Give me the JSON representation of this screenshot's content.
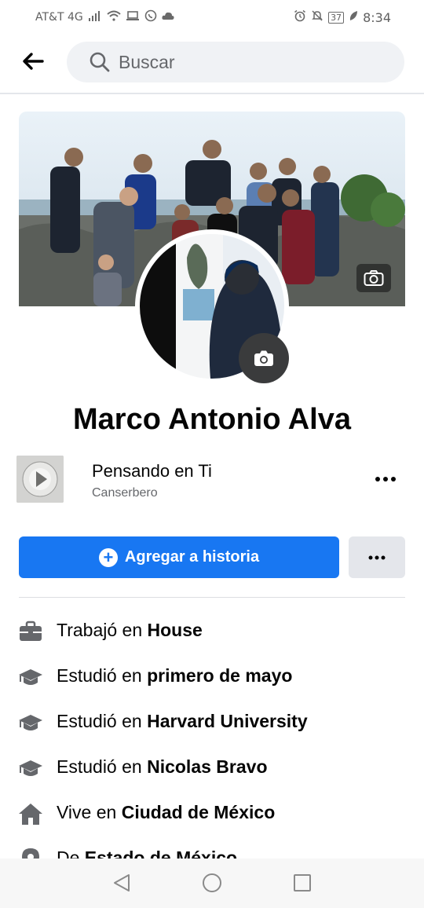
{
  "status_bar": {
    "carrier": "AT&T 4G",
    "battery": "37",
    "time": "8:34"
  },
  "search": {
    "placeholder": "Buscar"
  },
  "profile": {
    "name": "Marco Antonio Alva",
    "music": {
      "title": "Pensando en Ti",
      "artist": "Canserbero"
    }
  },
  "actions": {
    "add_story_label": "Agregar a historia",
    "more_label": "•••"
  },
  "details": [
    {
      "icon": "briefcase-icon",
      "prefix": "Trabajó en ",
      "value": "House"
    },
    {
      "icon": "graduation-cap-icon",
      "prefix": "Estudió en ",
      "value": "primero de mayo"
    },
    {
      "icon": "graduation-cap-icon",
      "prefix": "Estudió en ",
      "value": "Harvard University"
    },
    {
      "icon": "graduation-cap-icon",
      "prefix": "Estudió en ",
      "value": "Nicolas Bravo"
    },
    {
      "icon": "home-icon",
      "prefix": "Vive en ",
      "value": "Ciudad de México"
    },
    {
      "icon": "location-pin-icon",
      "prefix": "De ",
      "value": "Estado de México"
    }
  ],
  "colors": {
    "primary": "#1877f2",
    "secondary_button": "#e4e6eb",
    "text": "#050505",
    "muted_text": "#65676b"
  }
}
